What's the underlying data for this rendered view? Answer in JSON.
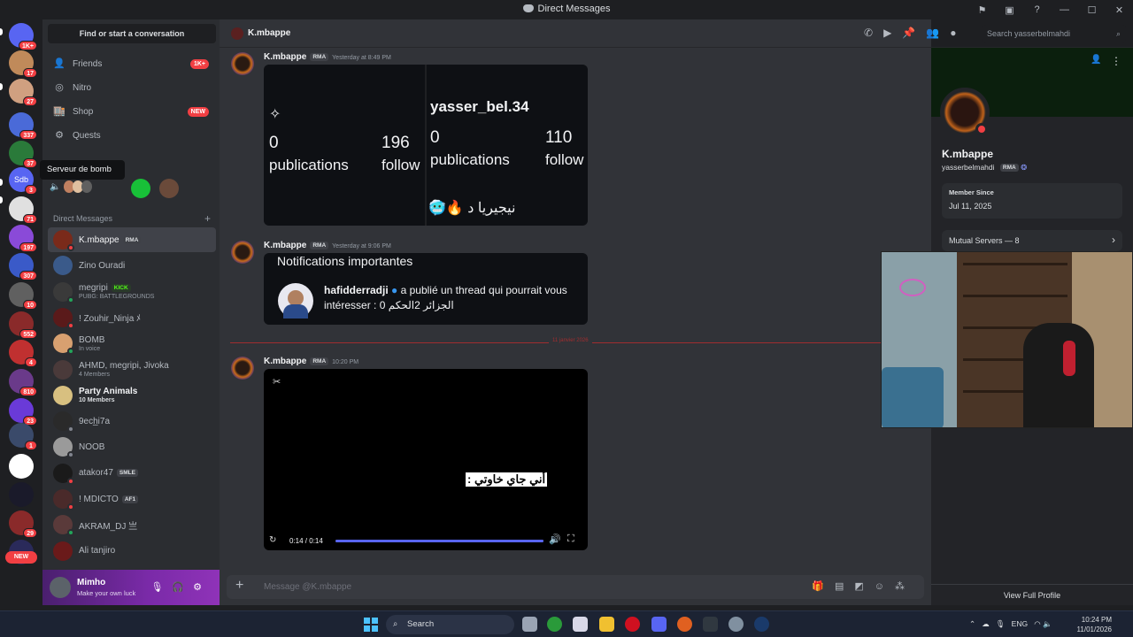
{
  "window": {
    "title": "Direct Messages"
  },
  "servers": [
    {
      "badge": "1K+"
    },
    {
      "badge": "17"
    },
    {
      "badge": "27"
    },
    {
      "badge": "337"
    },
    {
      "badge": "37"
    },
    {
      "badge": "3"
    },
    {
      "badge": "71"
    },
    {
      "badge": "197"
    },
    {
      "badge": "307"
    },
    {
      "badge": "10"
    },
    {
      "badge": "552"
    },
    {
      "badge": "4"
    },
    {
      "badge": "810"
    },
    {
      "badge": "23"
    },
    {
      "badge": "1"
    },
    {
      "badge": ""
    },
    {
      "badge": ""
    },
    {
      "badge": "29"
    },
    {
      "badge": ""
    }
  ],
  "rail": {
    "new_label": "NEW",
    "hover_text": "Sdb"
  },
  "tooltip": "Serveur de bomb",
  "sidebar": {
    "find": "Find or start a conversation",
    "nav": [
      {
        "label": "Friends",
        "badge": "1K+",
        "icon": "friends-icon"
      },
      {
        "label": "Nitro",
        "badge": "",
        "icon": "nitro-icon"
      },
      {
        "label": "Shop",
        "badge": "NEW",
        "icon": "shop-icon"
      },
      {
        "label": "Quests",
        "badge": "",
        "icon": "quests-icon"
      }
    ],
    "dm_header": "Direct Messages",
    "dms": [
      {
        "name": "K.mbappe",
        "tag": "RMA",
        "sub": "",
        "color": "#7a2a1a",
        "status": "#f23f43"
      },
      {
        "name": "Zino Ouradi",
        "tag": "",
        "sub": "",
        "color": "#3a5a8a",
        "status": ""
      },
      {
        "name": "megripi",
        "tag": "KICK",
        "sub": "PUBG: BATTLEGROUNDS",
        "color": "#3a3a3a",
        "status": "#23a55a"
      },
      {
        "name": "! Zouhir_Ninja ﾒ",
        "tag": "",
        "sub": "",
        "color": "#5a1a1a",
        "status": "#f23f43"
      },
      {
        "name": "BOMB",
        "tag": "",
        "sub": "In voice",
        "color": "#d8a070",
        "status": "#23a55a"
      },
      {
        "name": "AHMD, megripi, Jivoka",
        "tag": "",
        "sub": "4 Members",
        "color": "#4a3a3a",
        "status": ""
      },
      {
        "name": "Party Animals",
        "tag": "",
        "sub": "10 Members",
        "color": "#d8c080",
        "status": ""
      },
      {
        "name": "9ech̲i7a",
        "tag": "",
        "sub": "",
        "color": "#2a2a2a",
        "status": "#80848e"
      },
      {
        "name": "NOOB",
        "tag": "",
        "sub": "",
        "color": "#9a9a9a",
        "status": "#80848e"
      },
      {
        "name": "atakor47",
        "tag": "SMLE",
        "sub": "",
        "color": "#1a1a1a",
        "status": "#f23f43"
      },
      {
        "name": "! MDICTO",
        "tag": "AF1",
        "sub": "",
        "color": "#4a2a2a",
        "status": "#f23f43"
      },
      {
        "name": "AKRAM_DJ 亗",
        "tag": "",
        "sub": "",
        "color": "#5a3a3a",
        "status": "#23a55a"
      },
      {
        "name": "Ali tanjiro",
        "tag": "",
        "sub": "",
        "color": "#6a1a1a",
        "status": ""
      }
    ]
  },
  "user": {
    "name": "Mimho",
    "status": "Make your own luck"
  },
  "chat": {
    "header_name": "K.mbappe",
    "search_placeholder": "Search yasserbelmahdi",
    "messages": [
      {
        "author": "K.mbappe",
        "tag": "RMA",
        "time": "Yesterday at 8:49 PM"
      },
      {
        "author": "K.mbappe",
        "tag": "RMA",
        "time": "Yesterday at 9:06 PM"
      },
      {
        "author": "K.mbappe",
        "tag": "RMA",
        "time": "10:20 PM"
      }
    ],
    "insta_left": {
      "publications": "0",
      "pub_label": "publications",
      "followers": "196",
      "fol_label": "follow"
    },
    "insta_right": {
      "username": "yasser_bel.34",
      "publications": "0",
      "pub_label": "publications",
      "followers": "110",
      "fol_label": "follow",
      "bio": "نيجيريا د 🔥🥶"
    },
    "notif": {
      "title": "Notifications importantes",
      "user": "hafidderradji",
      "text": " a publié un thread qui pourrait vous intéresser : ",
      "text2": "0 الجزائر 2الحكم"
    },
    "divider": "11 janvier 2026",
    "video": {
      "caption": "أني جاي خاوتي :",
      "time": "0:14 / 0:14",
      "progress": 1.0
    },
    "composer_placeholder": "Message @K.mbappe"
  },
  "profile": {
    "name": "K.mbappe",
    "username": "yasserbelmahdi",
    "tag": "RMA",
    "member_since_label": "Member Since",
    "member_since": "Jul 11, 2025",
    "mutual": "Mutual Servers — 8",
    "view_full": "View Full Profile"
  },
  "taskbar": {
    "search": "Search",
    "lang": "ENG",
    "time": "10:24 PM",
    "date": "11/01/2026"
  }
}
